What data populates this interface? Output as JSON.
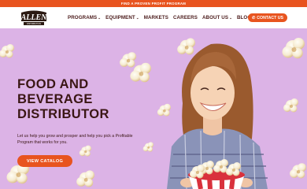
{
  "announcement": {
    "text": "FIND A PROVEN PROFIT PROGRAM"
  },
  "brand": {
    "logo_text": "ALLEN",
    "logo_subtext": "DISTRIBUTION"
  },
  "nav": {
    "items": [
      {
        "label": "PROGRAMS",
        "has_dropdown": true
      },
      {
        "label": "EQUIPMENT",
        "has_dropdown": true
      },
      {
        "label": "MARKETS",
        "has_dropdown": false
      },
      {
        "label": "CAREERS",
        "has_dropdown": false
      },
      {
        "label": "ABOUT US",
        "has_dropdown": true
      },
      {
        "label": "BLOGS",
        "has_dropdown": false
      }
    ],
    "dropdown_glyph": "⌄",
    "contact_label": "CONTACT US",
    "contact_icon": "phone-icon"
  },
  "hero": {
    "headline_lines": [
      "FOOD AND",
      "BEVERAGE",
      "DISTRIBUTOR"
    ],
    "subtext": "Let us help you grow and prosper and help you pick a Profitable Program that works for you.",
    "cta_label": "VIEW CATALOG"
  },
  "colors": {
    "accent": "#e8541f",
    "hero_bg": "#dcb3e6",
    "heading": "#3a1614"
  }
}
